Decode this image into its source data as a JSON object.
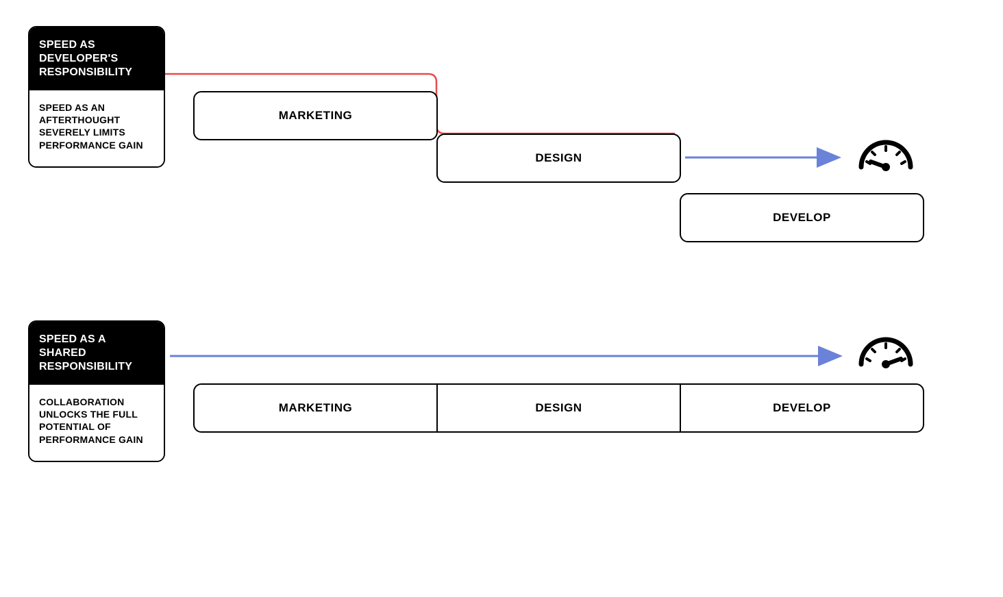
{
  "diagram1": {
    "card": {
      "header": "SPEED AS DEVELOPER'S RESPONSIBILITY",
      "body": "SPEED AS AN AFTERTHOUGHT SEVERELY LIMITS PERFORMANCE GAIN"
    },
    "stages": {
      "marketing": "MARKETING",
      "design": "DESIGN",
      "develop": "DEVELOP"
    }
  },
  "diagram2": {
    "card": {
      "header": "SPEED AS A SHARED RESPONSIBILITY",
      "body": "COLLABORATION UNLOCKS THE FULL POTENTIAL OF PERFORMANCE GAIN"
    },
    "stages": {
      "marketing": "MARKETING",
      "design": "DESIGN",
      "develop": "DEVELOP"
    }
  },
  "chart_data": {
    "type": "diagram",
    "title": "Speed Responsibility Models",
    "layouts": [
      {
        "name": "Speed as Developer's Responsibility",
        "description": "Speed as an afterthought severely limits performance gain",
        "flow": "waterfall",
        "stages": [
          "MARKETING",
          "DESIGN",
          "DEVELOP"
        ],
        "speed_arrow": {
          "from": "DEVELOP",
          "to": "gauge",
          "length_fraction": 0.25
        },
        "gauge_reading": "low"
      },
      {
        "name": "Speed as a Shared Responsibility",
        "description": "Collaboration unlocks the full potential of performance gain",
        "flow": "parallel",
        "stages": [
          "MARKETING",
          "DESIGN",
          "DEVELOP"
        ],
        "speed_arrow": {
          "from": "start",
          "to": "gauge",
          "length_fraction": 1.0
        },
        "gauge_reading": "high"
      }
    ]
  }
}
